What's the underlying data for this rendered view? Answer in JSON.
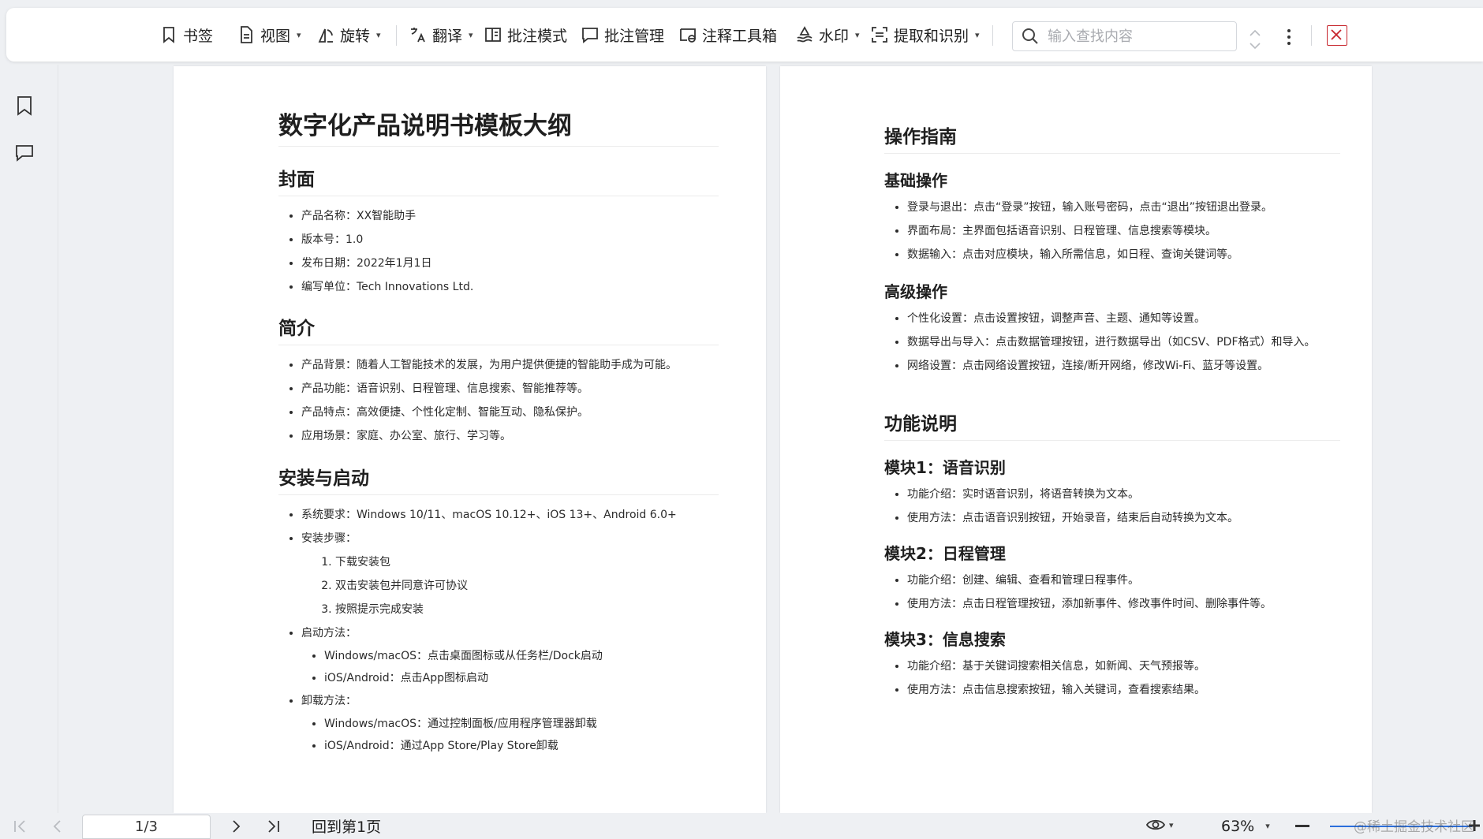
{
  "toolbar": {
    "bookmark": "书签",
    "view": "视图",
    "rotate": "旋转",
    "translate": "翻译",
    "annotate_mode": "批注模式",
    "annotate_manage": "批注管理",
    "annotate_tools": "注释工具箱",
    "watermark": "水印",
    "extract": "提取和识别",
    "search_placeholder": "输入查找内容"
  },
  "page_left": {
    "title": "数字化产品说明书模板大纲",
    "cover": {
      "heading": "封面",
      "items": [
        "产品名称：XX智能助手",
        "版本号：1.0",
        "发布日期：2022年1月1日",
        "编写单位：Tech Innovations Ltd."
      ]
    },
    "intro": {
      "heading": "简介",
      "items": [
        "产品背景：随着人工智能技术的发展，为用户提供便捷的智能助手成为可能。",
        "产品功能：语音识别、日程管理、信息搜索、智能推荐等。",
        "产品特点：高效便捷、个性化定制、智能互动、隐私保护。",
        "应用场景：家庭、办公室、旅行、学习等。"
      ]
    },
    "install": {
      "heading": "安装与启动",
      "sysreq": "系统要求：Windows 10/11、macOS 10.12+、iOS 13+、Android 6.0+",
      "steps_label": "安装步骤：",
      "steps": [
        "下载安装包",
        "双击安装包并同意许可协议",
        "按照提示完成安装"
      ],
      "launch_label": "启动方法：",
      "launch": [
        "Windows/macOS：点击桌面图标或从任务栏/Dock启动",
        "iOS/Android：点击App图标启动"
      ],
      "uninstall_label": "卸载方法：",
      "uninstall": [
        "Windows/macOS：通过控制面板/应用程序管理器卸载",
        "iOS/Android：通过App Store/Play Store卸载"
      ]
    }
  },
  "page_right": {
    "guide": {
      "heading": "操作指南",
      "basic_heading": "基础操作",
      "basic": [
        "登录与退出：点击“登录”按钮，输入账号密码，点击“退出”按钮退出登录。",
        "界面布局：主界面包括语音识别、日程管理、信息搜索等模块。",
        "数据输入：点击对应模块，输入所需信息，如日程、查询关键词等。"
      ],
      "advanced_heading": "高级操作",
      "advanced": [
        "个性化设置：点击设置按钮，调整声音、主题、通知等设置。",
        "数据导出与导入：点击数据管理按钮，进行数据导出（如CSV、PDF格式）和导入。",
        "网络设置：点击网络设置按钮，连接/断开网络，修改Wi-Fi、蓝牙等设置。"
      ]
    },
    "features": {
      "heading": "功能说明",
      "m1_heading": "模块1：语音识别",
      "m1": [
        "功能介绍：实时语音识别，将语音转换为文本。",
        "使用方法：点击语音识别按钮，开始录音，结束后自动转换为文本。"
      ],
      "m2_heading": "模块2：日程管理",
      "m2": [
        "功能介绍：创建、编辑、查看和管理日程事件。",
        "使用方法：点击日程管理按钮，添加新事件、修改事件时间、删除事件等。"
      ],
      "m3_heading": "模块3：信息搜索",
      "m3": [
        "功能介绍：基于关键词搜索相关信息，如新闻、天气预报等。",
        "使用方法：点击信息搜索按钮，输入关键词，查看搜索结果。"
      ]
    }
  },
  "statusbar": {
    "page_indicator": "1/3",
    "goto_first": "回到第1页",
    "zoom": "63%"
  },
  "watermark": "@稀土掘金技术社区",
  "colors": {
    "close_red": "#c7262d",
    "zoom_blue": "#2b6fdc"
  }
}
